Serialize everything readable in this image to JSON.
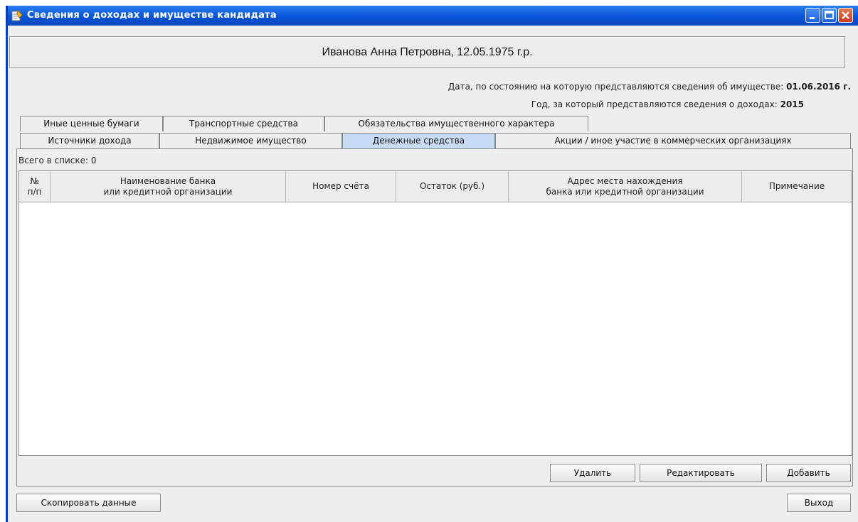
{
  "window": {
    "title": "Сведения о доходах и имуществе кандидата"
  },
  "header": {
    "person": "Иванова Анна Петровна, 12.05.1975 г.р."
  },
  "info": {
    "property_date_label": "Дата, по состоянию на которую представляются сведения об имуществе:",
    "property_date_value": "01.06.2016 г.",
    "income_year_label": "Год, за который представляются сведения о доходах:",
    "income_year_value": "2015"
  },
  "tabs": {
    "row1": [
      "Иные ценные бумаги",
      "Транспортные средства",
      "Обязательства имущественного характера"
    ],
    "row2": [
      "Источники дохода",
      "Недвижимое имущество",
      "Денежные средства",
      "Акции / иное участие в коммерческих организациях"
    ],
    "active": "Денежные средства"
  },
  "list": {
    "count_label": "Всего в списке: 0",
    "columns": [
      "№\nп/п",
      "Наименование банка\nили кредитной организации",
      "Номер счёта",
      "Остаток (руб.)",
      "Адрес места нахождения\nбанка или кредитной организации",
      "Примечание"
    ],
    "rows": []
  },
  "buttons": {
    "delete": "Удалить",
    "edit": "Редактировать",
    "add": "Добавить",
    "copy": "Скопировать данные",
    "exit": "Выход"
  }
}
